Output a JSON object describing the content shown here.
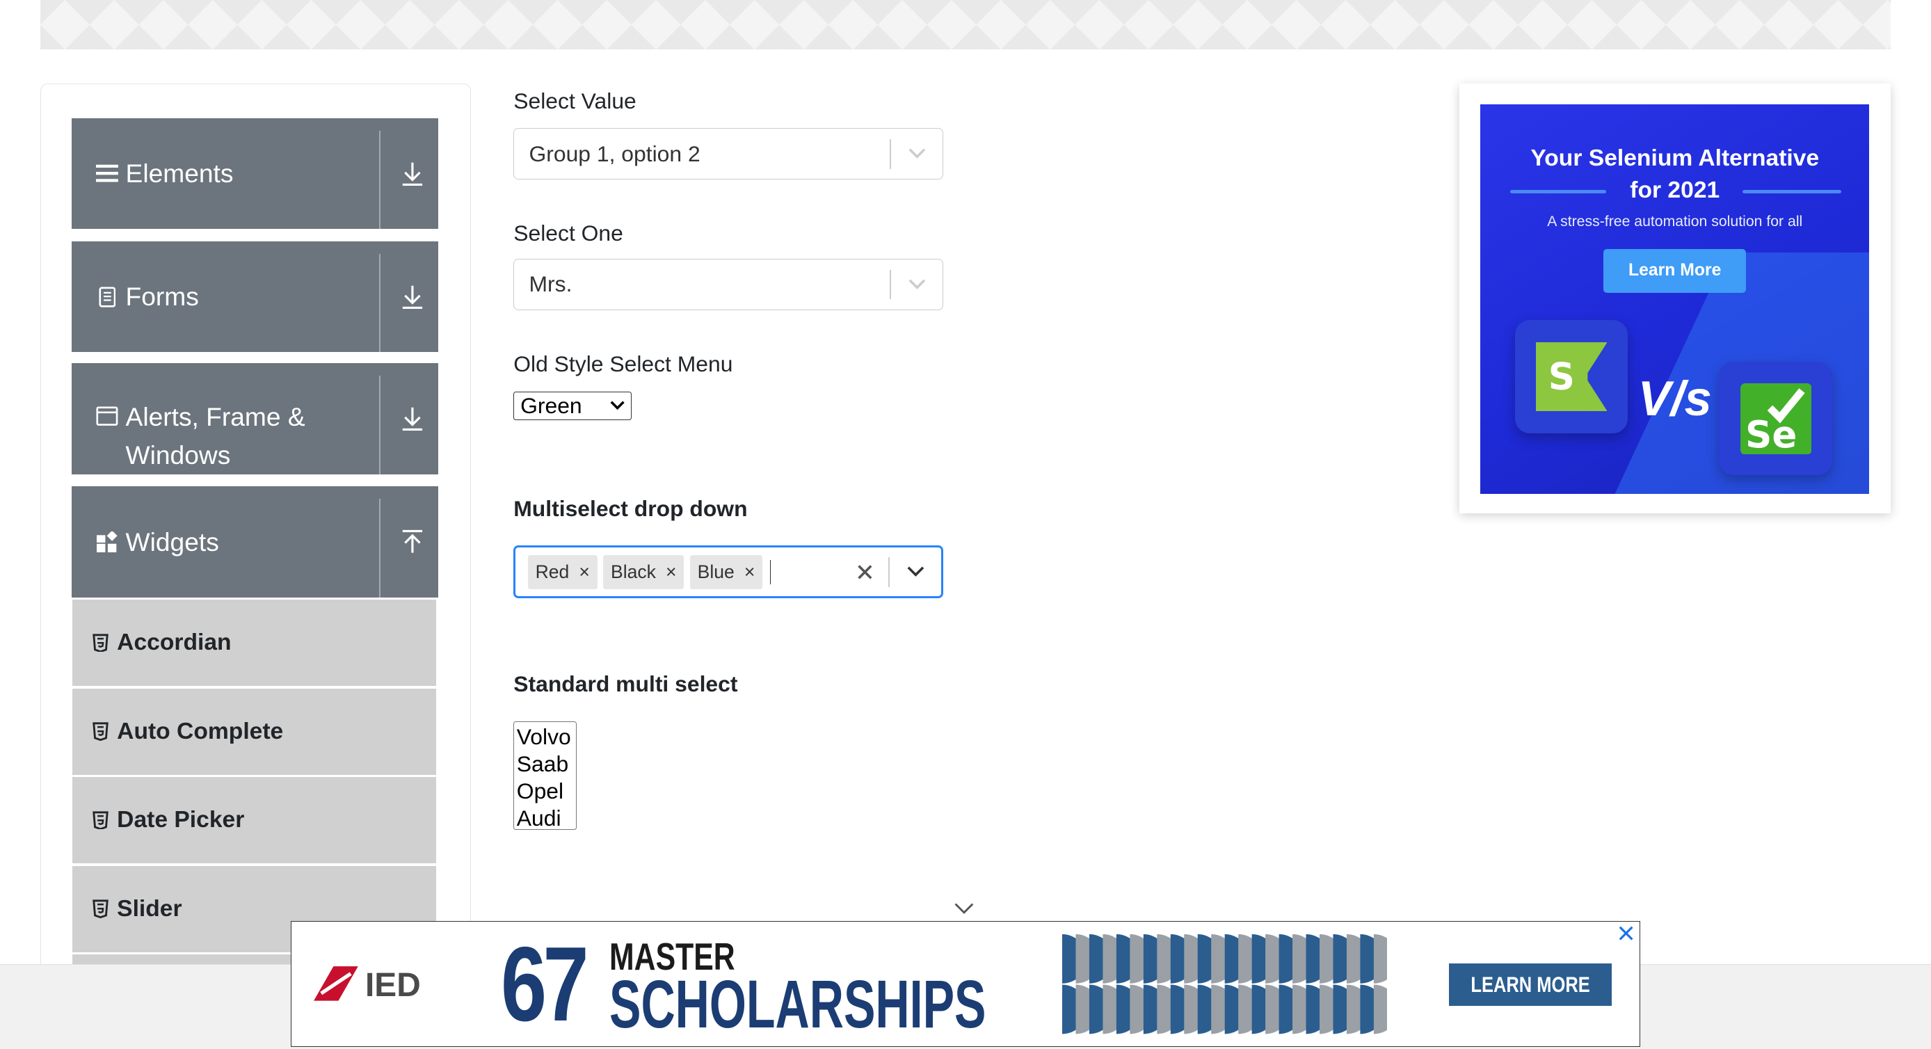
{
  "sidebar": {
    "groups": [
      {
        "label": "Elements",
        "icon": "menu-icon"
      },
      {
        "label": "Forms",
        "icon": "document-icon"
      },
      {
        "label": "Alerts, Frame & Windows",
        "icon": "window-icon"
      },
      {
        "label": "Widgets",
        "icon": "widgets-icon"
      }
    ],
    "widget_items": [
      {
        "label": "Accordian"
      },
      {
        "label": "Auto Complete"
      },
      {
        "label": "Date Picker"
      },
      {
        "label": "Slider"
      }
    ]
  },
  "form": {
    "select_value": {
      "label": "Select Value",
      "value": "Group 1, option 2"
    },
    "select_one": {
      "label": "Select One",
      "value": "Mrs."
    },
    "old_style": {
      "label": "Old Style Select Menu",
      "value": "Green"
    },
    "multiselect": {
      "label": "Multiselect drop down",
      "chips": [
        {
          "text": "Red",
          "remove": "×"
        },
        {
          "text": "Black",
          "remove": "×"
        },
        {
          "text": "Blue",
          "remove": "×"
        }
      ]
    },
    "standard_multi": {
      "label": "Standard multi select",
      "options": [
        "Volvo",
        "Saab",
        "Opel",
        "Audi"
      ]
    }
  },
  "side_ad": {
    "title_line1": "Your Selenium Alternative",
    "title_line2": "for 2021",
    "subtitle": "A stress-free automation solution for all",
    "button": "Learn More",
    "vs_text": "V/s",
    "brand_color": "#1e2ad6"
  },
  "bottom_ad": {
    "brand": "IED",
    "number": "67",
    "line1": "MASTER",
    "line2": "SCHOLARSHIPS",
    "button": "LEARN MORE",
    "brand_color": "#1b3d73"
  }
}
